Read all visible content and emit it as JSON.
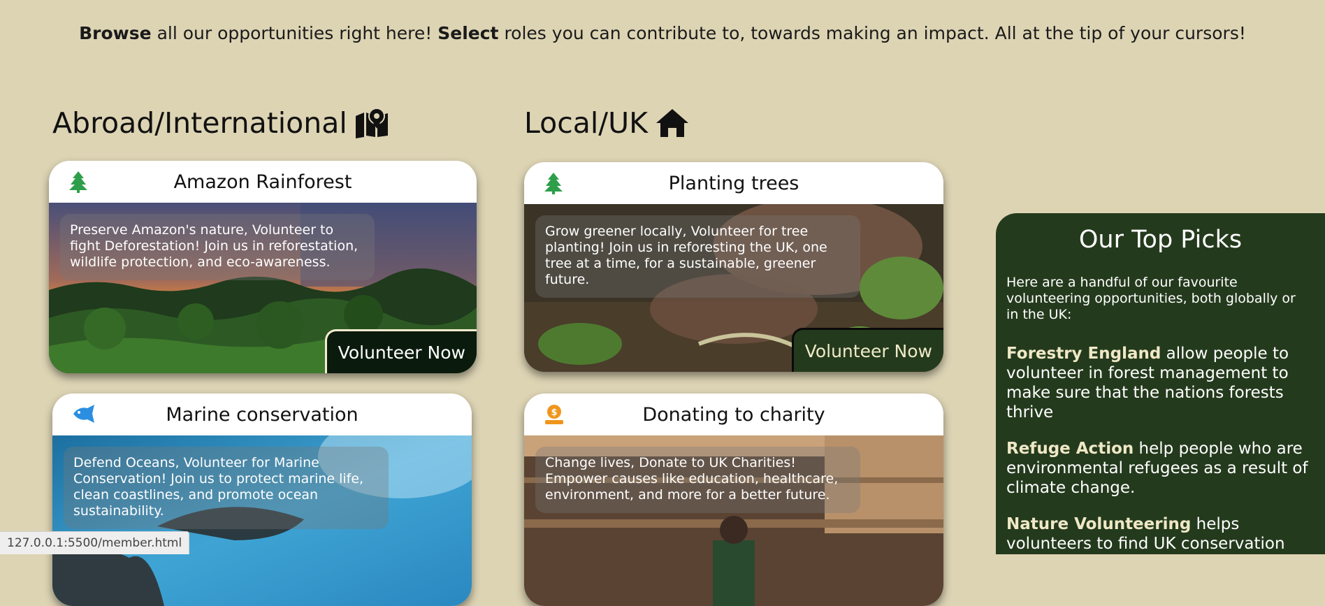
{
  "intro": {
    "browse": "Browse",
    "text1": " all our opportunities right here! ",
    "select": "Select",
    "text2": " roles you can contribute to, towards making an impact. All at the tip of your cursors!"
  },
  "abroad": {
    "heading": "Abroad/International",
    "icon": "map-location-icon",
    "cards": [
      {
        "title": "Amazon Rainforest",
        "icon": "tree-icon",
        "description": "Preserve Amazon's nature, Volunteer to fight Deforestation! Join us in reforestation, wildlife protection, and eco-awareness.",
        "button": "Volunteer Now"
      },
      {
        "title": "Marine conservation",
        "icon": "fish-icon",
        "description": "Defend Oceans, Volunteer for Marine Conservation! Join us to protect marine life, clean coastlines, and promote ocean sustainability."
      }
    ]
  },
  "local": {
    "heading": "Local/UK",
    "icon": "house-icon",
    "cards": [
      {
        "title": "Planting trees",
        "icon": "tree-icon",
        "description": "Grow greener locally, Volunteer for tree planting! Join us in reforesting the UK, one tree at a time, for a sustainable, greener future.",
        "button": "Volunteer Now"
      },
      {
        "title": "Donating to charity",
        "icon": "donation-icon",
        "description": "Change lives, Donate to UK Charities! Empower causes like education, healthcare, environment, and more for a better future."
      }
    ]
  },
  "top_picks": {
    "title": "Our Top Picks",
    "intro": "Here are a handful of our favourite volunteering opportunities, both globally or in the UK:",
    "items": [
      {
        "name": "Forestry England",
        "text": " allow people to volunteer in forest management to make sure that the nations forests thrive"
      },
      {
        "name": "Refuge Action",
        "text": " help people who are environmental refugees as a result of climate change."
      },
      {
        "name": "Nature Volunteering",
        "text": " helps volunteers to find UK conservation projects that"
      }
    ]
  },
  "status_bar": {
    "url": "127.0.0.1:5500/member.html"
  },
  "colors": {
    "page_background": "#ddd4b4",
    "panel_green": "#243a1d",
    "accent_cream": "#efe8c6",
    "tree_icon": "#2e9e4a",
    "fish_icon": "#2b8ee0",
    "donation_icon": "#f0951c"
  }
}
